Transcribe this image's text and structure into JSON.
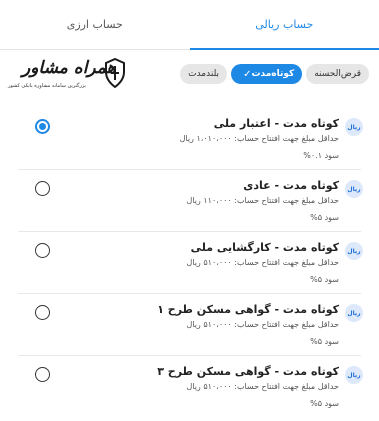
{
  "tabs": [
    {
      "label": "حساب ریالی",
      "active": true
    },
    {
      "label": "حساب ارزی",
      "active": false
    }
  ],
  "logo": {
    "title": "همراه مشاور",
    "tagline": "بزرگترین سامانه مشاوره بانکی کشور"
  },
  "filters": [
    {
      "label": "قرض‌الحسنه",
      "selected": false
    },
    {
      "label": "کوتاه‌مدت",
      "selected": true,
      "check_icon": "check-icon"
    },
    {
      "label": "بلندمدت",
      "selected": false
    }
  ],
  "accounts": [
    {
      "badge": "ریال",
      "title": "کوتاه مدت - اعتبار ملی",
      "min_deposit": "حداقل مبلغ جهت افتتاح حساب: ۱،۰۱۰،۰۰۰ ریال",
      "profit": "سود ۰.۱%",
      "selected": true
    },
    {
      "badge": "ریال",
      "title": "کوتاه مدت - عادی",
      "min_deposit": "حداقل مبلغ جهت افتتاح حساب: ۱۱۰،۰۰۰ ریال",
      "profit": "سود ۵%",
      "selected": false
    },
    {
      "badge": "ریال",
      "title": "کوتاه مدت - کارگشایی ملی",
      "min_deposit": "حداقل مبلغ جهت افتتاح حساب: ۵۱۰،۰۰۰ ریال",
      "profit": "سود ۵%",
      "selected": false
    },
    {
      "badge": "ریال",
      "title": "کوتاه مدت - گواهی مسکن طرح ۱",
      "min_deposit": "حداقل مبلغ جهت افتتاح حساب: ۵۱۰،۰۰۰ ریال",
      "profit": "سود ۵%",
      "selected": false
    },
    {
      "badge": "ریال",
      "title": "کوتاه مدت - گواهی مسکن طرح ۳",
      "min_deposit": "حداقل مبلغ جهت افتتاح حساب: ۵۱۰،۰۰۰ ریال",
      "profit": "سود ۵%",
      "selected": false
    }
  ],
  "colors": {
    "accent": "#1e88e5",
    "badge_bg": "#dde9fb",
    "chip_bg": "#e6e6e6"
  }
}
